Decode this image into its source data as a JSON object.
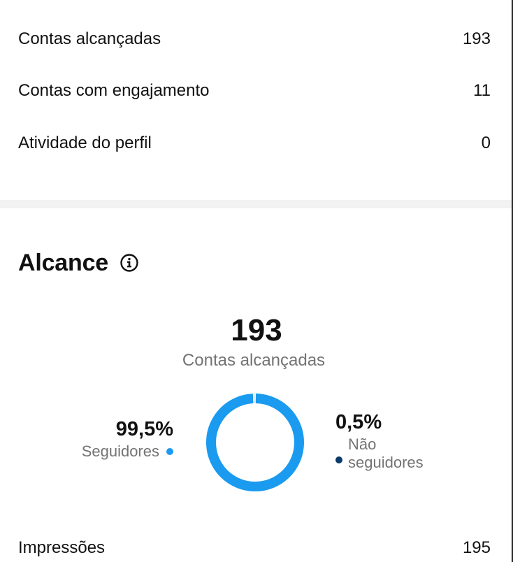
{
  "stats": [
    {
      "label": "Contas alcançadas",
      "value": "193"
    },
    {
      "label": "Contas com engajamento",
      "value": "11"
    },
    {
      "label": "Atividade do perfil",
      "value": "0"
    }
  ],
  "reach": {
    "title": "Alcance",
    "info_icon": "info-circle-icon",
    "total": "193",
    "total_label": "Contas alcançadas",
    "followers": {
      "percent_label": "99,5%",
      "label": "Seguidores",
      "share": 99.5,
      "color": "#1a9bf0"
    },
    "non_followers": {
      "percent_label": "0,5%",
      "label_line1": "Não",
      "label_line2": "seguidores",
      "share": 0.5,
      "color": "#0b3b6b"
    }
  },
  "impressions": {
    "label": "Impressões",
    "value": "195"
  }
}
